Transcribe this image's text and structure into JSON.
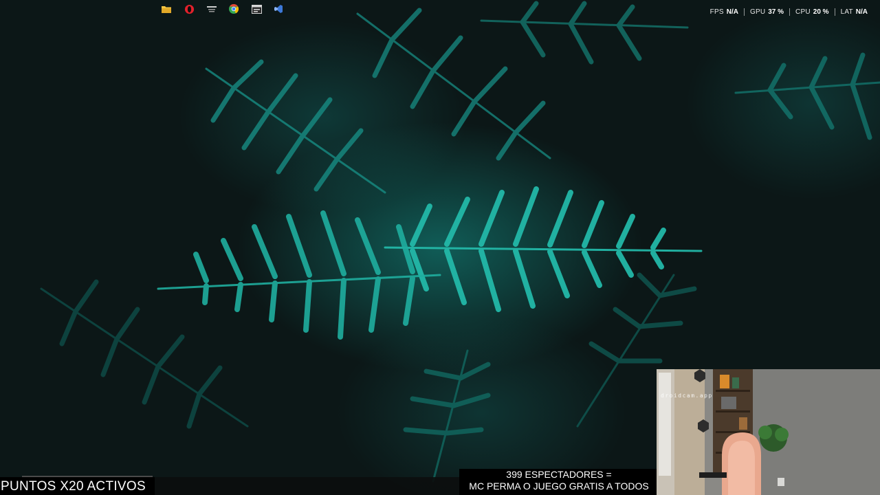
{
  "desktop": {
    "wallpaper_icon": "fern-leaves-wallpaper",
    "background_color": "#0c1717",
    "accent_color": "#1fa99c"
  },
  "perf_overlay": {
    "items": [
      {
        "label": "FPS",
        "value": "N/A"
      },
      {
        "label": "GPU",
        "value": "37 %"
      },
      {
        "label": "CPU",
        "value": "20 %"
      },
      {
        "label": "LAT",
        "value": "N/A"
      }
    ]
  },
  "taskbar": {
    "icons": [
      {
        "name": "file-explorer-icon",
        "color": "#f5c542"
      },
      {
        "name": "opera-icon",
        "color": "#e3212c"
      },
      {
        "name": "app-icon",
        "color": "#cfcfcf"
      },
      {
        "name": "chrome-icon",
        "color": "#34a853"
      },
      {
        "name": "window-app-icon",
        "color": "#d8d8d8"
      },
      {
        "name": "visual-studio-icon",
        "color": "#3c78d8"
      }
    ]
  },
  "stream_overlay": {
    "promo_text": "PUNTOS X20 ACTIVOS",
    "viewers_line1": "399 ESPECTADORES =",
    "viewers_line2": "MC PERMA O JUEGO GRATIS A TODOS"
  },
  "webcam": {
    "watermark": "droidcam.app"
  }
}
